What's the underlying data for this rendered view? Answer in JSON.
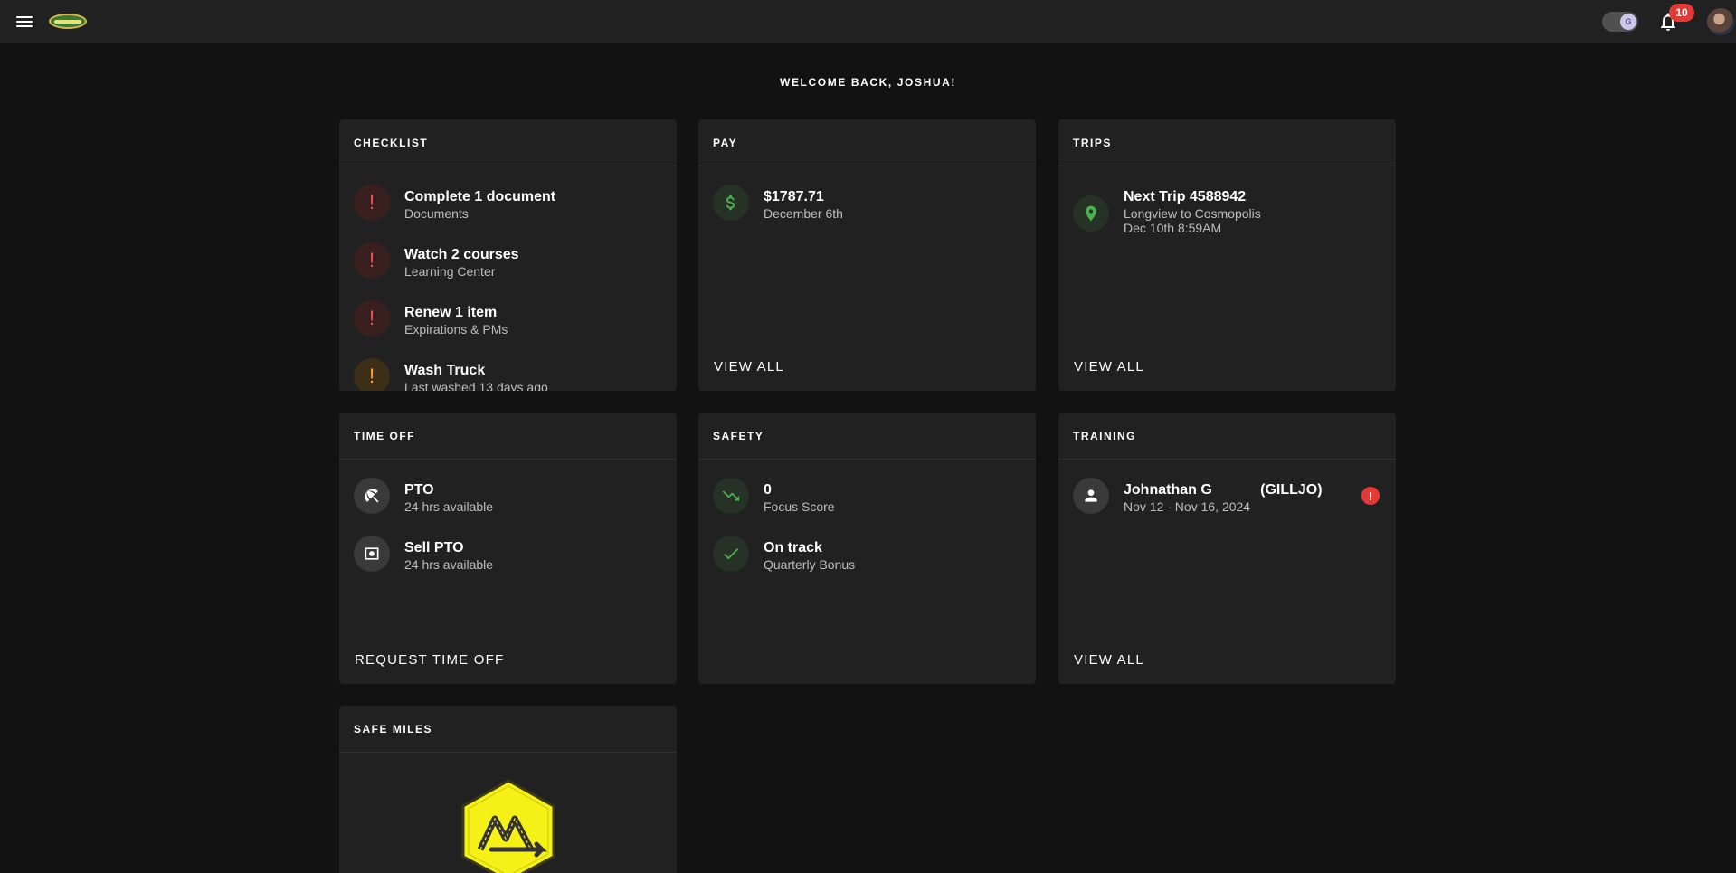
{
  "topbar": {
    "menu_icon": "hamburger-menu-icon",
    "logo_icon": "company-logo",
    "toggle_icon": "theme-toggle",
    "toggle_knob_text": "G",
    "notifications_icon": "bell-icon",
    "notifications_count": "10",
    "avatar_icon": "user-avatar"
  },
  "welcome": "WELCOME BACK, JOSHUA!",
  "checklist": {
    "title": "CHECKLIST",
    "items": [
      {
        "title": "Complete 1 document",
        "subtitle": "Documents",
        "icon": "exclamation-icon",
        "level": "error"
      },
      {
        "title": "Watch 2 courses",
        "subtitle": "Learning Center",
        "icon": "exclamation-icon",
        "level": "error"
      },
      {
        "title": "Renew 1 item",
        "subtitle": "Expirations & PMs",
        "icon": "exclamation-icon",
        "level": "error"
      },
      {
        "title": "Wash Truck",
        "subtitle": "Last washed 13 days ago",
        "icon": "exclamation-icon",
        "level": "warning"
      }
    ]
  },
  "pay": {
    "title": "PAY",
    "amount": "$1787.71",
    "date": "December 6th",
    "icon": "dollar-icon",
    "action": "VIEW ALL"
  },
  "trips": {
    "title": "TRIPS",
    "line1": "Next Trip 4588942",
    "line2": "Longview to Cosmopolis",
    "line3": "Dec 10th 8:59AM",
    "icon": "map-pin-icon",
    "action": "VIEW ALL"
  },
  "time_off": {
    "title": "TIME OFF",
    "items": [
      {
        "title": "PTO",
        "subtitle": "24 hrs available",
        "icon": "beach-umbrella-icon"
      },
      {
        "title": "Sell PTO",
        "subtitle": "24 hrs available",
        "icon": "money-icon"
      }
    ],
    "action": "REQUEST TIME OFF"
  },
  "safety": {
    "title": "SAFETY",
    "items": [
      {
        "title": "0",
        "subtitle": "Focus Score",
        "icon": "trending-down-icon"
      },
      {
        "title": "On track",
        "subtitle": "Quarterly Bonus",
        "icon": "check-icon"
      }
    ]
  },
  "training": {
    "title": "TRAINING",
    "name": "Johnathan G            (GILLJO)",
    "dates": "Nov 12 - Nov 16, 2024",
    "icon": "person-icon",
    "alert_icon": "alert-icon",
    "alert_text": "!",
    "action": "VIEW ALL"
  },
  "safe_miles": {
    "title": "SAFE MILES",
    "badge_icon": "safe-miles-badge",
    "colors": {
      "badge_fill": "#f5f015",
      "badge_border": "#3a3a14"
    }
  },
  "colors": {
    "background": "#121212",
    "surface": "#212121",
    "error": "#ef5350",
    "warning": "#ffa726",
    "success": "#4caf50",
    "badge": "#e53935"
  }
}
